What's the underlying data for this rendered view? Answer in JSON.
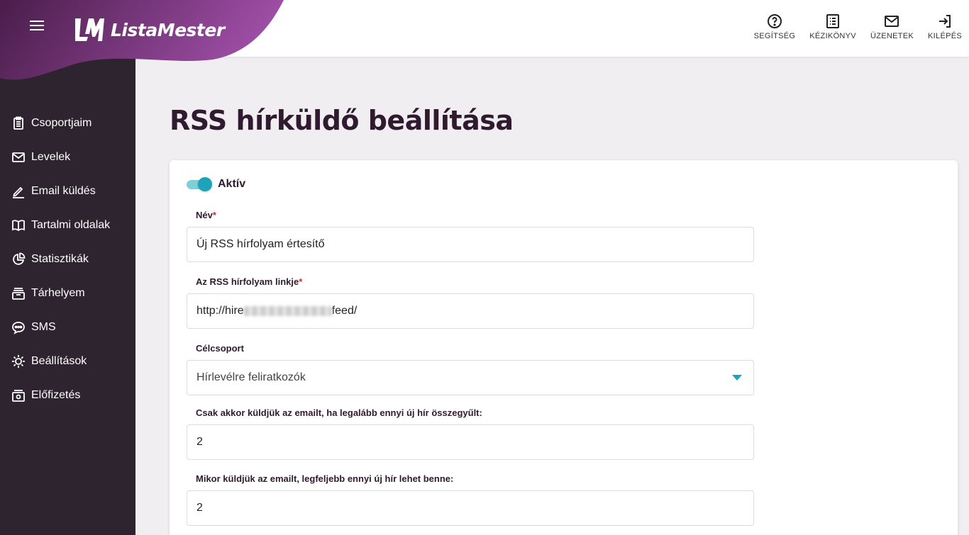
{
  "header": {
    "brand": "ListaMester",
    "nav": [
      {
        "label": "SEGÍTSÉG",
        "icon": "help-circle-icon"
      },
      {
        "label": "KÉZIKÖNYV",
        "icon": "manual-icon"
      },
      {
        "label": "ÜZENETEK",
        "icon": "mail-icon"
      },
      {
        "label": "KILÉPÉS",
        "icon": "logout-icon"
      }
    ]
  },
  "sidebar": {
    "items": [
      {
        "label": "Csoportjaim",
        "icon": "clipboard-icon"
      },
      {
        "label": "Levelek",
        "icon": "envelope-icon"
      },
      {
        "label": "Email küldés",
        "icon": "pen-icon"
      },
      {
        "label": "Tartalmi oldalak",
        "icon": "book-icon"
      },
      {
        "label": "Statisztikák",
        "icon": "pie-chart-icon"
      },
      {
        "label": "Tárhelyem",
        "icon": "storage-icon"
      },
      {
        "label": "SMS",
        "icon": "sms-bubble-icon"
      },
      {
        "label": "Beállítások",
        "icon": "gear-icon"
      },
      {
        "label": "Előfizetés",
        "icon": "subscription-icon"
      }
    ]
  },
  "page": {
    "title": "RSS hírküldő beállítása"
  },
  "form": {
    "active_label": "Aktív",
    "active": true,
    "name": {
      "label": "Név",
      "required_mark": "*",
      "value": "Új RSS hírfolyam értesítő"
    },
    "rss_link": {
      "label": "Az RSS hírfolyam linkje",
      "required_mark": "*",
      "value_start": "http://hire",
      "value_end": "feed/"
    },
    "target_group": {
      "label": "Célcsoport",
      "value": "Hírlevélre feliratkozók"
    },
    "min_items": {
      "label": "Csak akkor küldjük az emailt, ha legalább ennyi új hír összegyűlt:",
      "value": "2"
    },
    "max_items": {
      "label": "Mikor küldjük az emailt, legfeljebb ennyi új hír lehet benne:",
      "value": "2"
    }
  },
  "colors": {
    "brand_gradient_start": "#4a1d4a",
    "brand_gradient_end": "#a04fa8",
    "sidebar_bg": "#2e2430",
    "accent": "#1fa3b8"
  }
}
